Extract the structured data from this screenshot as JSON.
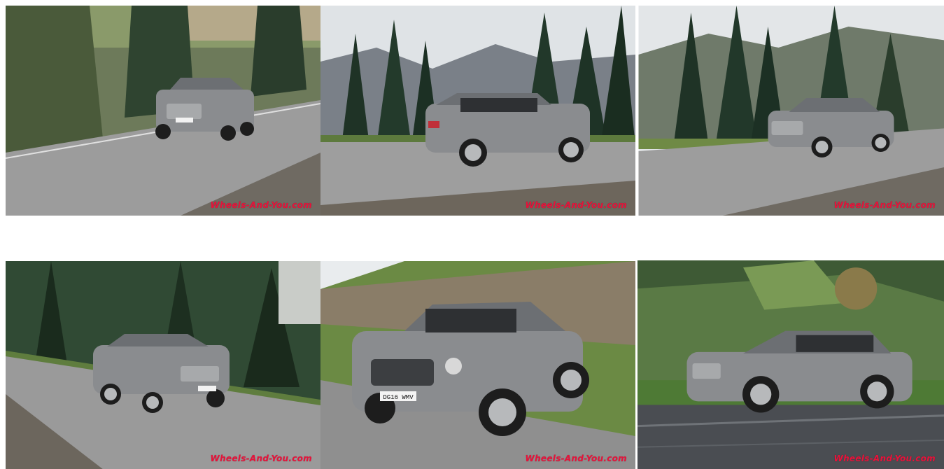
{
  "gallery": {
    "watermark": "Wheels-And-You.com",
    "tiles": [
      {
        "plate": ""
      },
      {
        "plate": ""
      },
      {
        "plate": ""
      },
      {
        "plate": ""
      },
      {
        "plate": "DG16 WMV"
      },
      {
        "plate": ""
      }
    ]
  },
  "colors": {
    "watermark": "#e8123a",
    "car_body": "#8a8c8f",
    "road": "#9a9a9a",
    "forest": "#2f4a32",
    "sky": "#e6e8ea"
  }
}
